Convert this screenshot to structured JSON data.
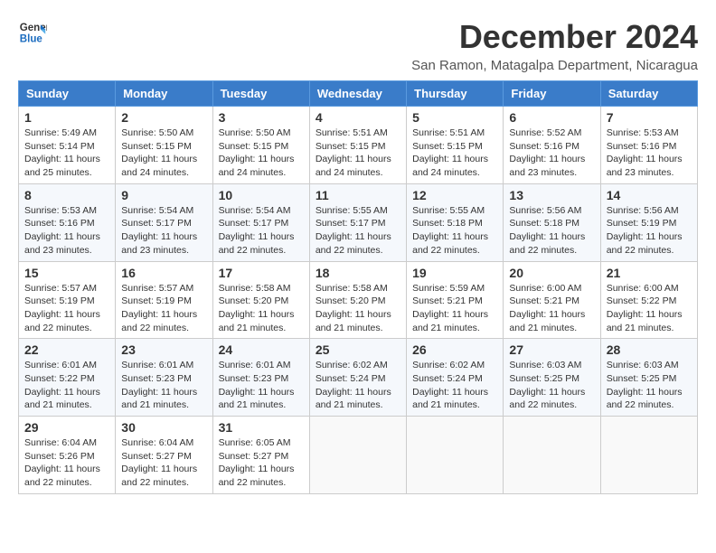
{
  "header": {
    "logo_line1": "General",
    "logo_line2": "Blue",
    "month_title": "December 2024",
    "location": "San Ramon, Matagalpa Department, Nicaragua"
  },
  "columns": [
    "Sunday",
    "Monday",
    "Tuesday",
    "Wednesday",
    "Thursday",
    "Friday",
    "Saturday"
  ],
  "weeks": [
    [
      {
        "day": "1",
        "sunrise": "5:49 AM",
        "sunset": "5:14 PM",
        "daylight": "11 hours and 25 minutes."
      },
      {
        "day": "2",
        "sunrise": "5:50 AM",
        "sunset": "5:15 PM",
        "daylight": "11 hours and 24 minutes."
      },
      {
        "day": "3",
        "sunrise": "5:50 AM",
        "sunset": "5:15 PM",
        "daylight": "11 hours and 24 minutes."
      },
      {
        "day": "4",
        "sunrise": "5:51 AM",
        "sunset": "5:15 PM",
        "daylight": "11 hours and 24 minutes."
      },
      {
        "day": "5",
        "sunrise": "5:51 AM",
        "sunset": "5:15 PM",
        "daylight": "11 hours and 24 minutes."
      },
      {
        "day": "6",
        "sunrise": "5:52 AM",
        "sunset": "5:16 PM",
        "daylight": "11 hours and 23 minutes."
      },
      {
        "day": "7",
        "sunrise": "5:53 AM",
        "sunset": "5:16 PM",
        "daylight": "11 hours and 23 minutes."
      }
    ],
    [
      {
        "day": "8",
        "sunrise": "5:53 AM",
        "sunset": "5:16 PM",
        "daylight": "11 hours and 23 minutes."
      },
      {
        "day": "9",
        "sunrise": "5:54 AM",
        "sunset": "5:17 PM",
        "daylight": "11 hours and 23 minutes."
      },
      {
        "day": "10",
        "sunrise": "5:54 AM",
        "sunset": "5:17 PM",
        "daylight": "11 hours and 22 minutes."
      },
      {
        "day": "11",
        "sunrise": "5:55 AM",
        "sunset": "5:17 PM",
        "daylight": "11 hours and 22 minutes."
      },
      {
        "day": "12",
        "sunrise": "5:55 AM",
        "sunset": "5:18 PM",
        "daylight": "11 hours and 22 minutes."
      },
      {
        "day": "13",
        "sunrise": "5:56 AM",
        "sunset": "5:18 PM",
        "daylight": "11 hours and 22 minutes."
      },
      {
        "day": "14",
        "sunrise": "5:56 AM",
        "sunset": "5:19 PM",
        "daylight": "11 hours and 22 minutes."
      }
    ],
    [
      {
        "day": "15",
        "sunrise": "5:57 AM",
        "sunset": "5:19 PM",
        "daylight": "11 hours and 22 minutes."
      },
      {
        "day": "16",
        "sunrise": "5:57 AM",
        "sunset": "5:19 PM",
        "daylight": "11 hours and 22 minutes."
      },
      {
        "day": "17",
        "sunrise": "5:58 AM",
        "sunset": "5:20 PM",
        "daylight": "11 hours and 21 minutes."
      },
      {
        "day": "18",
        "sunrise": "5:58 AM",
        "sunset": "5:20 PM",
        "daylight": "11 hours and 21 minutes."
      },
      {
        "day": "19",
        "sunrise": "5:59 AM",
        "sunset": "5:21 PM",
        "daylight": "11 hours and 21 minutes."
      },
      {
        "day": "20",
        "sunrise": "6:00 AM",
        "sunset": "5:21 PM",
        "daylight": "11 hours and 21 minutes."
      },
      {
        "day": "21",
        "sunrise": "6:00 AM",
        "sunset": "5:22 PM",
        "daylight": "11 hours and 21 minutes."
      }
    ],
    [
      {
        "day": "22",
        "sunrise": "6:01 AM",
        "sunset": "5:22 PM",
        "daylight": "11 hours and 21 minutes."
      },
      {
        "day": "23",
        "sunrise": "6:01 AM",
        "sunset": "5:23 PM",
        "daylight": "11 hours and 21 minutes."
      },
      {
        "day": "24",
        "sunrise": "6:01 AM",
        "sunset": "5:23 PM",
        "daylight": "11 hours and 21 minutes."
      },
      {
        "day": "25",
        "sunrise": "6:02 AM",
        "sunset": "5:24 PM",
        "daylight": "11 hours and 21 minutes."
      },
      {
        "day": "26",
        "sunrise": "6:02 AM",
        "sunset": "5:24 PM",
        "daylight": "11 hours and 21 minutes."
      },
      {
        "day": "27",
        "sunrise": "6:03 AM",
        "sunset": "5:25 PM",
        "daylight": "11 hours and 22 minutes."
      },
      {
        "day": "28",
        "sunrise": "6:03 AM",
        "sunset": "5:25 PM",
        "daylight": "11 hours and 22 minutes."
      }
    ],
    [
      {
        "day": "29",
        "sunrise": "6:04 AM",
        "sunset": "5:26 PM",
        "daylight": "11 hours and 22 minutes."
      },
      {
        "day": "30",
        "sunrise": "6:04 AM",
        "sunset": "5:27 PM",
        "daylight": "11 hours and 22 minutes."
      },
      {
        "day": "31",
        "sunrise": "6:05 AM",
        "sunset": "5:27 PM",
        "daylight": "11 hours and 22 minutes."
      },
      null,
      null,
      null,
      null
    ]
  ]
}
